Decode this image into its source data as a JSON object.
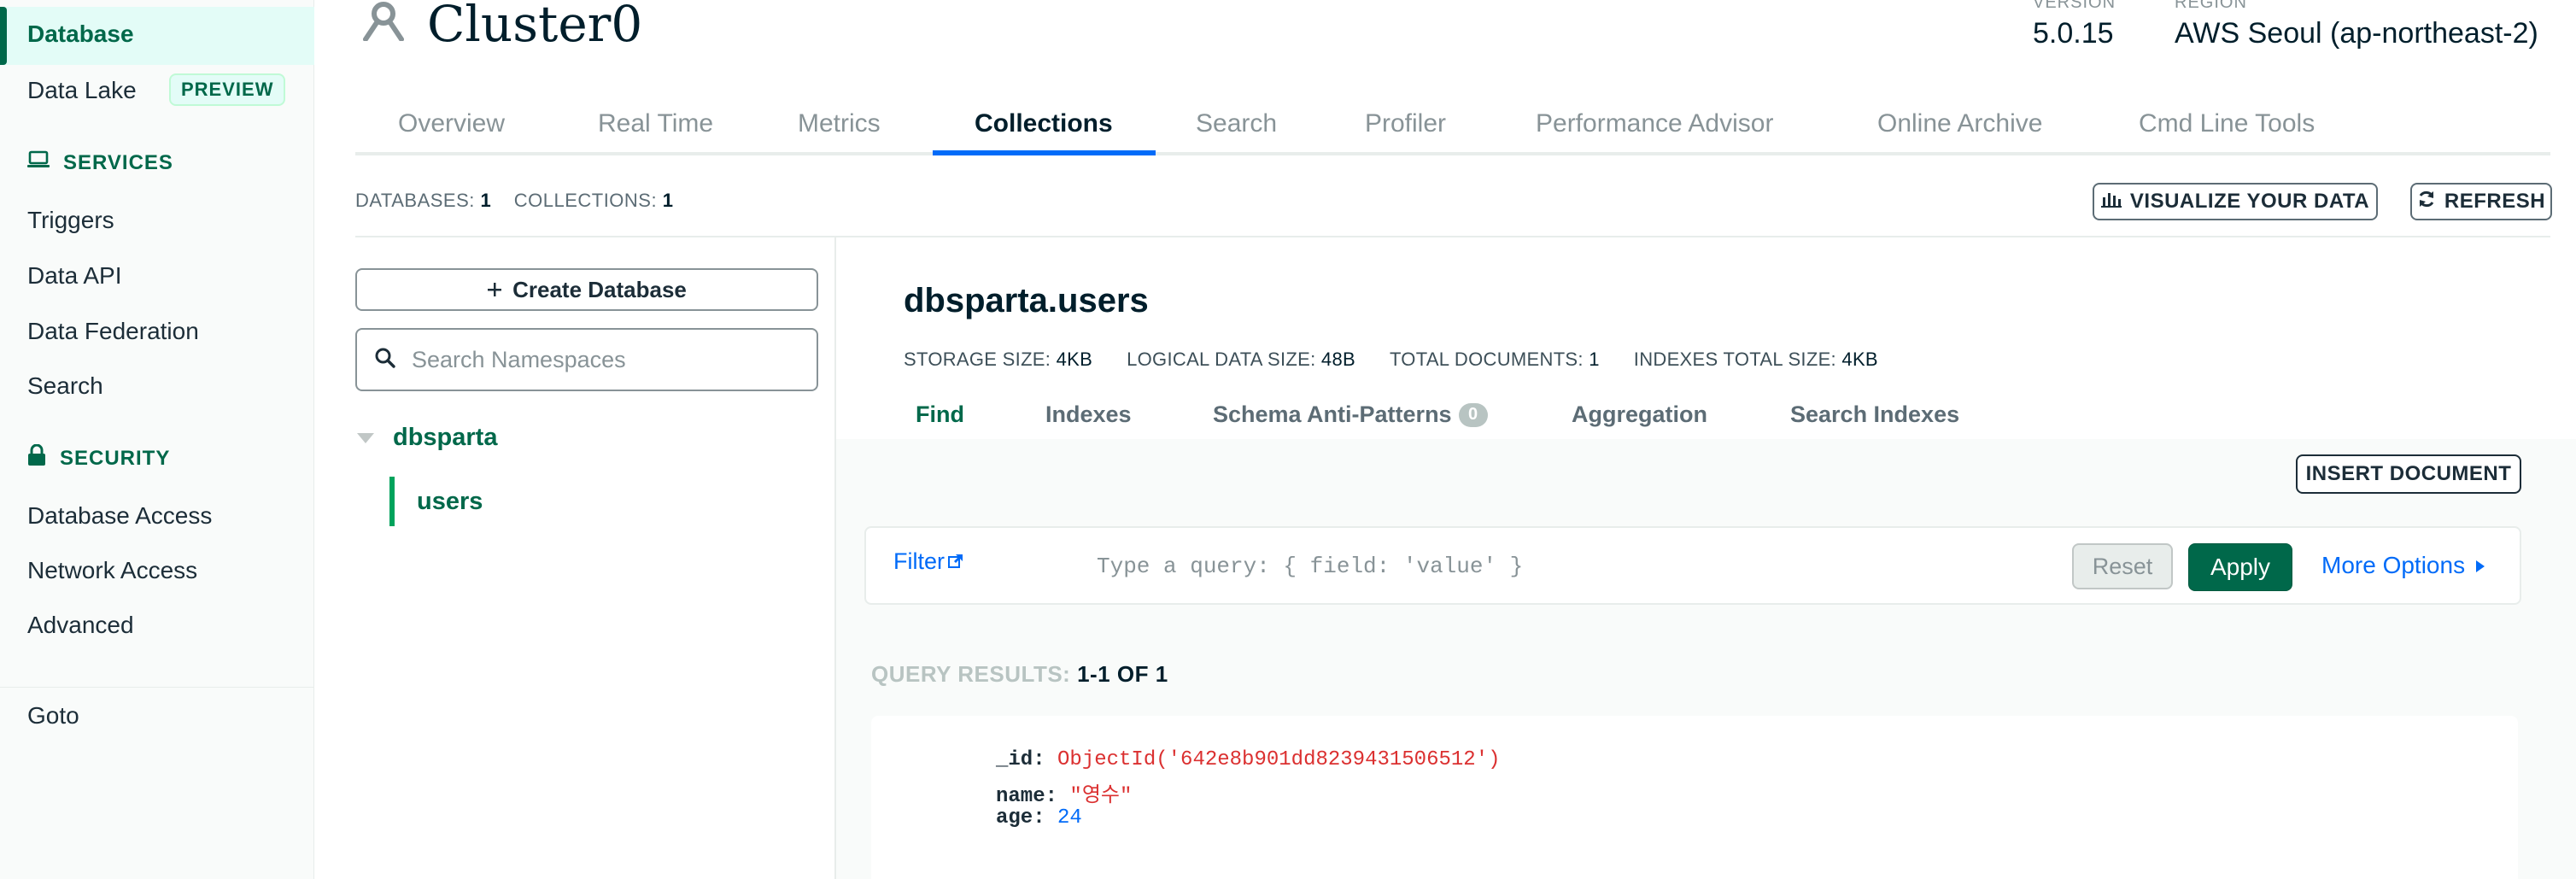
{
  "sidebar": {
    "items_top": [
      {
        "label": "Database"
      },
      {
        "label": "Data Lake",
        "badge": "PREVIEW"
      }
    ],
    "services_title": "SERVICES",
    "services": [
      "Triggers",
      "Data API",
      "Data Federation",
      "Search"
    ],
    "security_title": "SECURITY",
    "security": [
      "Database Access",
      "Network Access",
      "Advanced"
    ],
    "goto": "Goto"
  },
  "header": {
    "cluster_name": "Cluster0",
    "version_label": "VERSION",
    "version": "5.0.15",
    "region_label": "REGION",
    "region": "AWS Seoul (ap-northeast-2)"
  },
  "tabs": [
    "Overview",
    "Real Time",
    "Metrics",
    "Collections",
    "Search",
    "Profiler",
    "Performance Advisor",
    "Online Archive",
    "Cmd Line Tools"
  ],
  "active_tab": "Collections",
  "counts": {
    "databases_label": "DATABASES:",
    "databases": "1",
    "collections_label": "COLLECTIONS:",
    "collections": "1"
  },
  "actions": {
    "visualize": "VISUALIZE YOUR DATA",
    "refresh": "REFRESH"
  },
  "namespace": {
    "create_db": "Create Database",
    "search_placeholder": "Search Namespaces",
    "database": "dbsparta",
    "collection": "users"
  },
  "collection": {
    "title": "dbsparta.users",
    "stats": {
      "storage_label": "STORAGE SIZE:",
      "storage": "4KB",
      "logical_label": "LOGICAL DATA SIZE:",
      "logical": "48B",
      "docs_label": "TOTAL DOCUMENTS:",
      "docs": "1",
      "indexes_label": "INDEXES TOTAL SIZE:",
      "indexes": "4KB"
    },
    "subtabs": [
      "Find",
      "Indexes",
      "Schema Anti-Patterns",
      "Aggregation",
      "Search Indexes"
    ],
    "schema_badge": "0",
    "insert_document": "INSERT DOCUMENT"
  },
  "filter": {
    "label": "Filter",
    "placeholder": "Type a query: { field: 'value' }",
    "reset": "Reset",
    "apply": "Apply",
    "more_options": "More Options"
  },
  "results": {
    "label": "QUERY RESULTS:",
    "range": "1-1 OF 1"
  },
  "document": {
    "id_key": "_id:",
    "id_value": "ObjectId('642e8b901dd8239431506512')",
    "name_key": "name:",
    "name_value": "\"영수\"",
    "age_key": "age:",
    "age_value": "24"
  },
  "colors": {
    "brand_green": "#00684a",
    "link_blue": "#016bf8",
    "tab_underline": "#016bf8"
  }
}
